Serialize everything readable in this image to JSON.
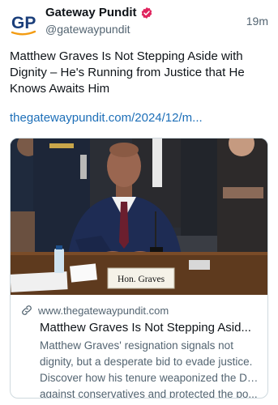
{
  "post": {
    "author_name": "Gateway Pundit",
    "handle": "@gatewaypundit",
    "time": "19m",
    "avatar_letters": "GP",
    "text": "Matthew Graves Is Not Stepping Aside with Dignity – He's Running from Justice that He Knows Awaits Him",
    "link": "thegatewaypundit.com/2024/12/m..."
  },
  "card": {
    "domain": "www.thegatewaypundit.com",
    "title": "Matthew Graves Is Not Stepping Asid...",
    "description_lines": [
      "Matthew Graves' resignation signals not",
      "dignity, but a desperate bid to evade justice.",
      "Discover how his tenure weaponized the DOJ",
      "against conservatives and protected the po..."
    ],
    "nameplate": "Hon. Graves"
  },
  "colors": {
    "link": "#1d6fb8",
    "verified": "#e0245e",
    "muted": "#536471",
    "logo_blue": "#1a3e7a",
    "logo_orange": "#f39c12"
  },
  "icons": {
    "verified": "verified-badge-icon",
    "link": "link-icon"
  }
}
